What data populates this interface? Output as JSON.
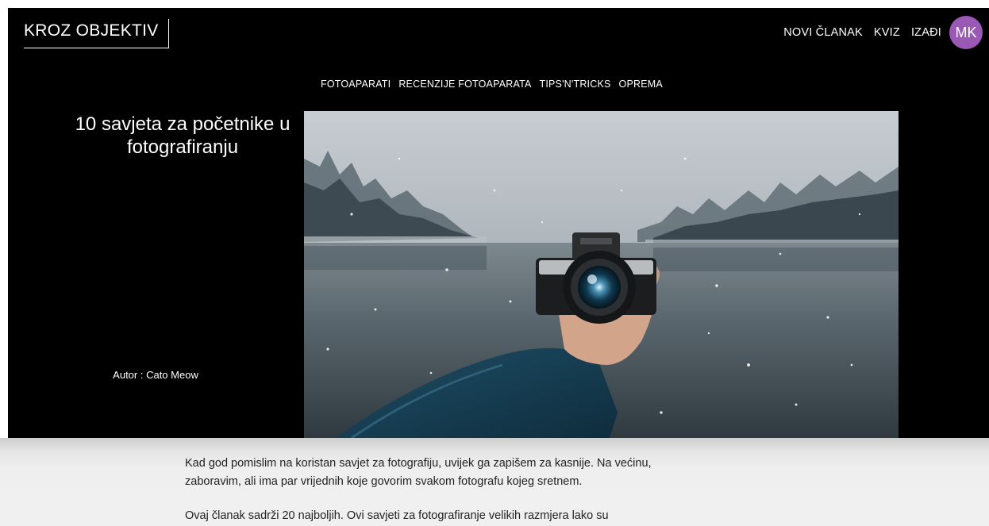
{
  "header": {
    "brand": "KROZ OBJEKTIV",
    "nav": {
      "new_article": "NOVI ČLANAK",
      "quiz": "KVIZ",
      "logout": "IZAĐI"
    },
    "avatar_initials": "MK",
    "avatar_color": "#9b59b6"
  },
  "categories": [
    "FOTOAPARATI",
    "RECENZIJE FOTOAPARATA",
    "TIPS'N'TRICKS",
    "OPREMA"
  ],
  "article": {
    "title": "10 savjeta za početnike u fotografiranju",
    "author": "Autor : Cato Meow",
    "paragraphs": [
      "Kad god pomislim na koristan savjet za fotografiju, uvijek ga zapišem za kasnije. Na većinu, zaboravim, ali ima par vrijednih koje govorim svakom fotografu kojeg sretnem.",
      "Ovaj članak sadrži 20 najboljih. Ovi savjeti za fotografiranje velikih razmjera lako su"
    ]
  }
}
